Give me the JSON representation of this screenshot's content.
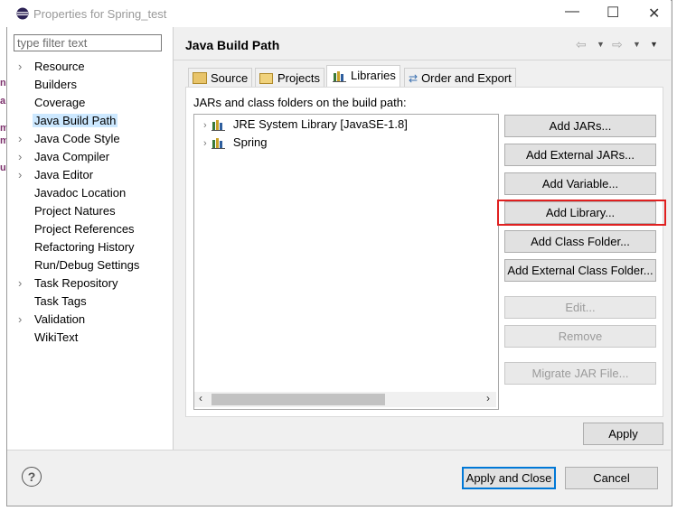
{
  "window": {
    "title": "Properties for Spring_test",
    "minimize_glyph": "—",
    "maximize_glyph": "☐",
    "close_glyph": "✕"
  },
  "filter": {
    "placeholder": "type filter text",
    "value": ""
  },
  "nav": {
    "items": [
      {
        "label": "Resource",
        "expandable": true
      },
      {
        "label": "Builders",
        "expandable": false
      },
      {
        "label": "Coverage",
        "expandable": false
      },
      {
        "label": "Java Build Path",
        "expandable": false,
        "selected": true
      },
      {
        "label": "Java Code Style",
        "expandable": true
      },
      {
        "label": "Java Compiler",
        "expandable": true
      },
      {
        "label": "Java Editor",
        "expandable": true
      },
      {
        "label": "Javadoc Location",
        "expandable": false
      },
      {
        "label": "Project Natures",
        "expandable": false
      },
      {
        "label": "Project References",
        "expandable": false
      },
      {
        "label": "Refactoring History",
        "expandable": false
      },
      {
        "label": "Run/Debug Settings",
        "expandable": false
      },
      {
        "label": "Task Repository",
        "expandable": true
      },
      {
        "label": "Task Tags",
        "expandable": false
      },
      {
        "label": "Validation",
        "expandable": true
      },
      {
        "label": "WikiText",
        "expandable": false
      }
    ]
  },
  "page": {
    "title": "Java Build Path",
    "tabs": [
      "Source",
      "Projects",
      "Libraries",
      "Order and Export"
    ],
    "active_tab": "Libraries",
    "description": "JARs and class folders on the build path:",
    "tree": [
      {
        "label": "JRE System Library [JavaSE-1.8]"
      },
      {
        "label": "Spring"
      }
    ],
    "buttons": {
      "add_jars": "Add JARs...",
      "add_external_jars": "Add External JARs...",
      "add_variable": "Add Variable...",
      "add_library": "Add Library...",
      "add_class_folder": "Add Class Folder...",
      "add_external_class_folder": "Add External Class Folder...",
      "edit": "Edit...",
      "remove": "Remove",
      "migrate_jar": "Migrate JAR File..."
    },
    "apply": "Apply"
  },
  "footer": {
    "help_glyph": "?",
    "apply_and_close": "Apply and Close",
    "cancel": "Cancel"
  },
  "colors": {
    "highlight": "#e02020",
    "selection": "#cce8ff",
    "default_button_border": "#0078d7"
  }
}
